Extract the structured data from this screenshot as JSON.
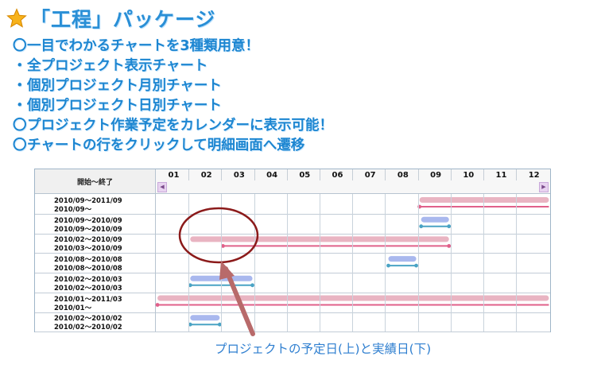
{
  "title": "「工程」パッケージ",
  "bullets": [
    {
      "mark": "〇",
      "text": "一目でわかるチャートを3種類用意！"
    },
    {
      "mark": "・",
      "text": "全プロジェクト表示チャート"
    },
    {
      "mark": "・",
      "text": "個別プロジェクト月別チャート"
    },
    {
      "mark": "・",
      "text": "個別プロジェクト日別チャート"
    },
    {
      "mark": "〇",
      "text": "プロジェクト作業予定をカレンダーに表示可能！"
    },
    {
      "mark": "〇",
      "text": "チャートの行をクリックして明細画面へ遷移"
    }
  ],
  "chart": {
    "header_label": "開始～終了",
    "months": [
      "01",
      "02",
      "03",
      "04",
      "05",
      "06",
      "07",
      "08",
      "09",
      "10",
      "11",
      "12"
    ],
    "rows": [
      {
        "plan": "2010/09～2011/09",
        "actual": "2010/09～"
      },
      {
        "plan": "2010/09～2010/09",
        "actual": "2010/09～2010/09"
      },
      {
        "plan": "2010/02～2010/09",
        "actual": "2010/03～2010/09"
      },
      {
        "plan": "2010/08～2010/08",
        "actual": "2010/08～2010/08"
      },
      {
        "plan": "2010/02～2010/03",
        "actual": "2010/02～2010/03"
      },
      {
        "plan": "2010/01～2011/03",
        "actual": "2010/01～"
      },
      {
        "plan": "2010/02～2010/02",
        "actual": "2010/02～2010/02"
      }
    ],
    "bar_colors": {
      "long_plan": "#e9b4c2",
      "long_actual": "#e0608a",
      "short_plan": "#a9b8ee",
      "short_actual": "#4aa3c4"
    }
  },
  "callout": "プロジェクトの予定日(上)と実績日(下)",
  "colors": {
    "heading": "#2a8fd6",
    "annotation": "#8b1a1a"
  }
}
